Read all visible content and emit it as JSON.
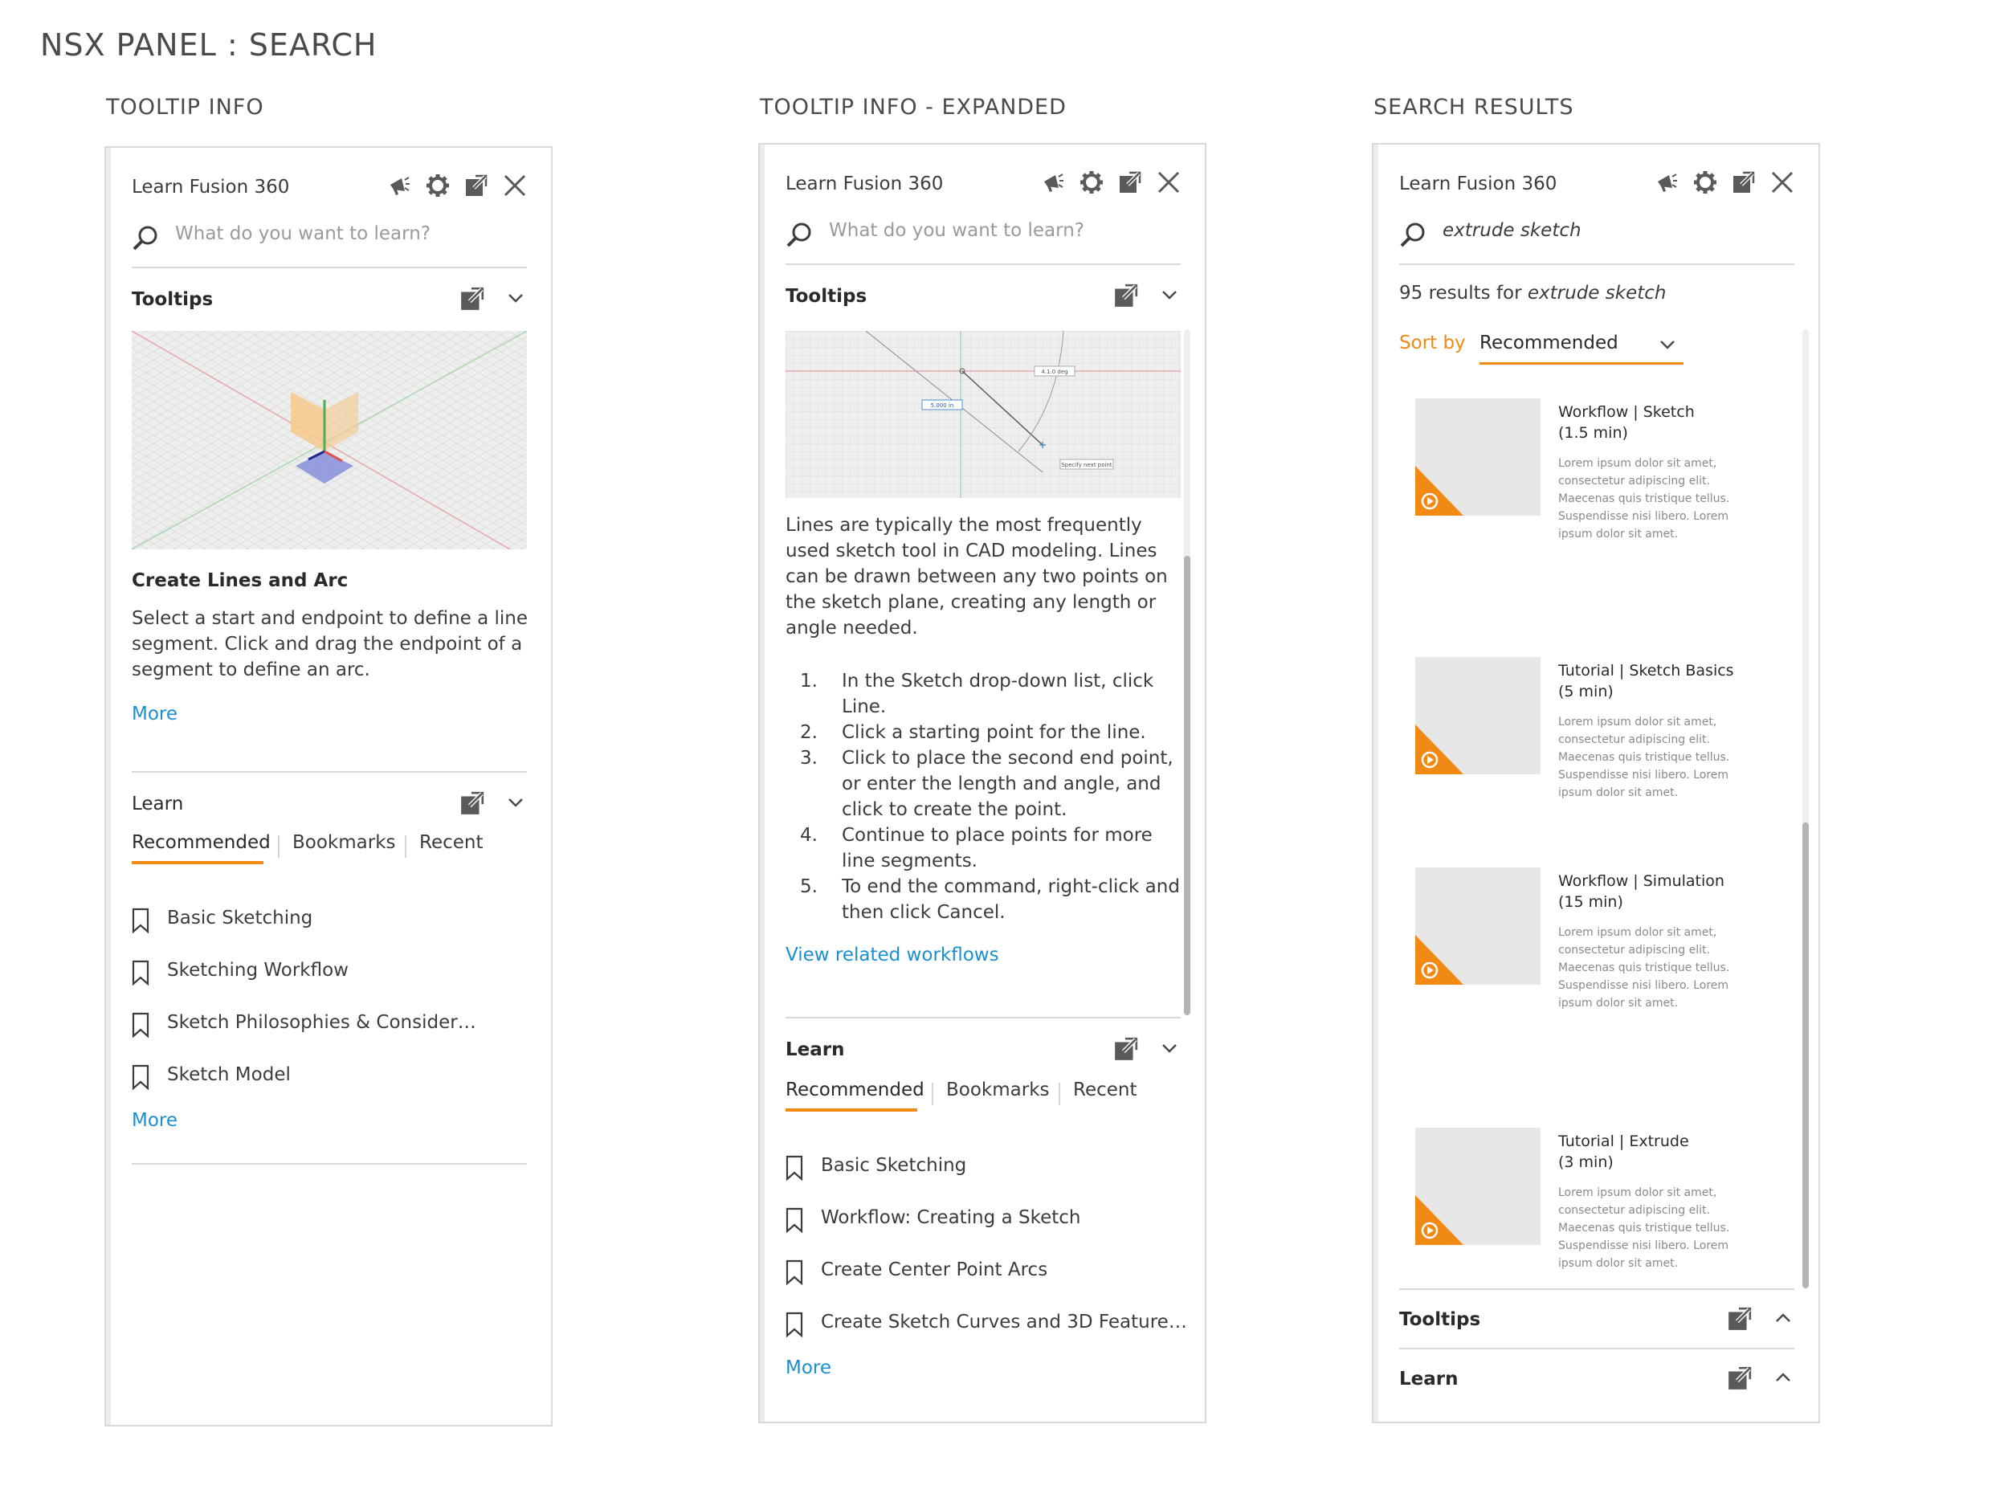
{
  "page": {
    "title": "NSX PANEL : SEARCH"
  },
  "columns": [
    {
      "title": "TOOLTIP INFO"
    },
    {
      "title": "TOOLTIP INFO - EXPANDED"
    },
    {
      "title": "SEARCH RESULTS"
    }
  ],
  "colors": {
    "accent": "#f08a14",
    "link": "#1b8fd1"
  },
  "panel": {
    "title": "Learn Fusion 360",
    "icons": [
      "megaphone-icon",
      "gear-icon",
      "popout-icon",
      "close-icon"
    ],
    "search_placeholder": "What do you want to learn?"
  },
  "panel1": {
    "tooltips_title": "Tooltips",
    "heading": "Create Lines and Arc",
    "body": "Select a start and endpoint to define a line segment. Click and drag the endpoint of a segment to define an arc.",
    "more": "More",
    "learn_title": "Learn",
    "tabs": [
      "Recommended",
      "Bookmarks",
      "Recent"
    ],
    "items": [
      "Basic Sketching",
      "Sketching Workflow",
      "Sketch Philosophies & Consider…",
      "Sketch Model"
    ],
    "learn_more": "More"
  },
  "panel2": {
    "tooltips_title": "Tooltips",
    "image_labels": [
      "4.1.0 deg",
      "5.000 in",
      "Specify next point"
    ],
    "body": "Lines are typically the most frequently used sketch tool in CAD modeling. Lines can be drawn between any two points on the sketch plane, creating any length or angle needed.",
    "steps": [
      {
        "n": "1.",
        "text": "In the Sketch drop-down list, click Line."
      },
      {
        "n": "2.",
        "text": "Click a starting point for the line."
      },
      {
        "n": "3.",
        "text": "Click to place the second end point, or enter the length and angle, and click to create the point."
      },
      {
        "n": "4.",
        "text": "Continue to place points for more line segments."
      },
      {
        "n": "5.",
        "text": "To end the command, right-click and then click Cancel."
      }
    ],
    "related_link": "View related workflows",
    "learn_title": "Learn",
    "tabs": [
      "Recommended",
      "Bookmarks",
      "Recent"
    ],
    "items": [
      "Basic Sketching",
      "Workflow: Creating a Sketch",
      "Create Center Point Arcs",
      "Create Sketch Curves and 3D Feature…"
    ],
    "learn_more": "More"
  },
  "panel3": {
    "search_value": "extrude sketch",
    "results_count": "95 results for",
    "results_query": "extrude sketch",
    "sort_label": "Sort by",
    "sort_value": "Recommended",
    "results": [
      {
        "title": "Workflow | Sketch",
        "duration": "(1.5 min)",
        "desc": "Lorem ipsum dolor sit amet, consectetur adipiscing elit. Maecenas quis tristique tellus. Suspendisse nisi libero. Lorem ipsum dolor sit amet."
      },
      {
        "title": "Tutorial | Sketch Basics",
        "duration": "(5 min)",
        "desc": "Lorem ipsum dolor sit amet, consectetur adipiscing elit. Maecenas quis tristique tellus. Suspendisse nisi libero. Lorem ipsum dolor sit amet."
      },
      {
        "title": "Workflow | Simulation",
        "duration": "(15 min)",
        "desc": "Lorem ipsum dolor sit amet, consectetur adipiscing elit. Maecenas quis tristique tellus. Suspendisse nisi libero. Lorem ipsum dolor sit amet."
      },
      {
        "title": "Tutorial | Extrude",
        "duration": "(3 min)",
        "desc": "Lorem ipsum dolor sit amet, consectetur adipiscing elit. Maecenas quis tristique tellus. Suspendisse nisi libero. Lorem ipsum dolor sit amet."
      }
    ],
    "tooltips_title": "Tooltips",
    "learn_title": "Learn"
  }
}
